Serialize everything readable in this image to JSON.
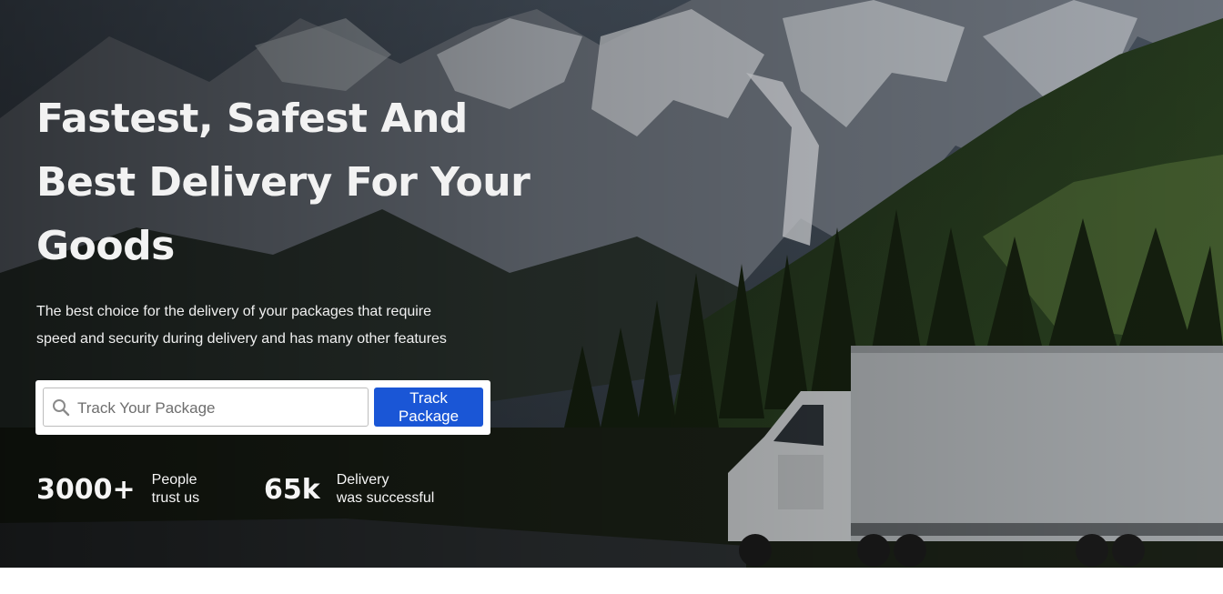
{
  "hero": {
    "title_lines": [
      "Fastest, Safest And",
      "Best Delivery For Your",
      "Goods"
    ],
    "subtitle_lines": [
      "The best choice for the delivery of your packages that require",
      "speed and security during delivery and has many other features"
    ]
  },
  "track": {
    "placeholder": "Track Your Package",
    "value": "",
    "button_label": "Track Package",
    "button_color": "#1a56d6"
  },
  "stats": [
    {
      "value": "3000+",
      "label_lines": [
        "People",
        "trust us"
      ]
    },
    {
      "value": "65k",
      "label_lines": [
        "Delivery",
        "was successful"
      ]
    }
  ],
  "background": {
    "scene": "mountain-truck-photo"
  }
}
